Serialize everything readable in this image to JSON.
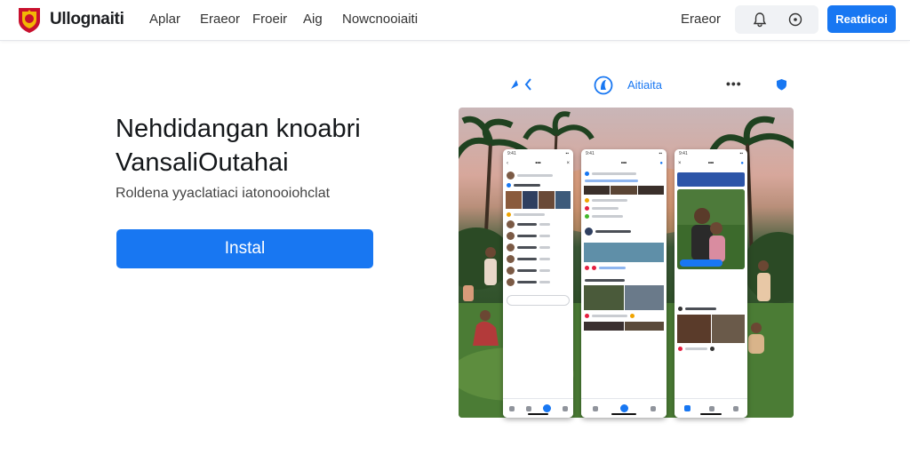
{
  "header": {
    "brand": "Ullognaiti",
    "nav": [
      "Aplar",
      "Eraeor",
      "Froeir",
      "Aig",
      "Nowcnooiaiti"
    ],
    "right_link": "Eraeor",
    "cta": "Reatdicoi"
  },
  "hero": {
    "title_line1": "Nehdidangan knoabri",
    "title_line2": "VansaliOutahai",
    "subtitle": "Roldena yyaclatiaci iatonooiohclat",
    "install": "Instal"
  },
  "preview": {
    "title": "Aitiaita",
    "more": "•••"
  },
  "colors": {
    "accent": "#1877f2",
    "text": "#1c1e21",
    "logo_red": "#c8102e",
    "logo_gold": "#f2b705"
  },
  "icons": [
    "logo-crest-icon",
    "bell-icon",
    "settings-icon",
    "back-icon",
    "app-badge-icon",
    "shield-icon"
  ]
}
